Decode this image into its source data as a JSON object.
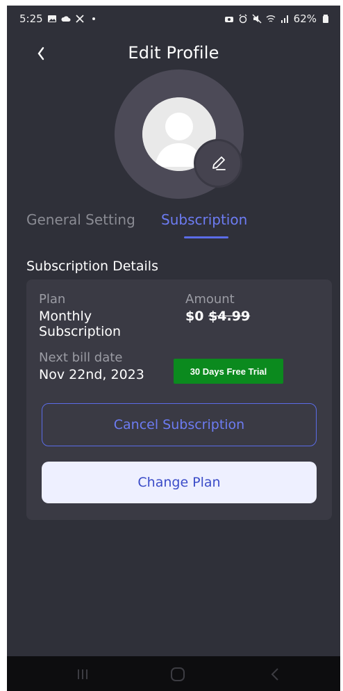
{
  "status_bar": {
    "time": "5:25",
    "battery_text": "62%",
    "left_icons": [
      "gallery-icon",
      "cloud-icon",
      "x-logo-icon",
      "dot-icon"
    ],
    "right_icons": [
      "camera-icon",
      "alarm-icon",
      "mute-icon",
      "wifi-icon",
      "signal-icon",
      "battery-icon"
    ]
  },
  "header": {
    "title": "Edit Profile",
    "back_icon": "chevron-left-icon"
  },
  "avatar": {
    "placeholder_icon": "user-silhouette-icon",
    "edit_icon": "pencil-icon"
  },
  "tabs": [
    {
      "label": "General Setting",
      "active": false
    },
    {
      "label": "Subscription",
      "active": true
    }
  ],
  "subscription": {
    "section_title": "Subscription Details",
    "plan_label": "Plan",
    "plan_value_line1": "Monthly",
    "plan_value_line2": "Subscription",
    "amount_label": "Amount",
    "amount_current": "$0",
    "amount_original": "$4.99",
    "next_bill_label": "Next bill date",
    "next_bill_value": "Nov 22nd, 2023",
    "trial_badge": "30 Days Free Trial",
    "cancel_button": "Cancel Subscription",
    "change_button": "Change Plan"
  },
  "nav_bar": {
    "icons": [
      "recent-apps-icon",
      "home-icon",
      "back-icon"
    ]
  },
  "colors": {
    "background": "#2f3039",
    "card": "#3a3a44",
    "accent": "#5b6ce8",
    "badge": "#0b8a1e"
  }
}
